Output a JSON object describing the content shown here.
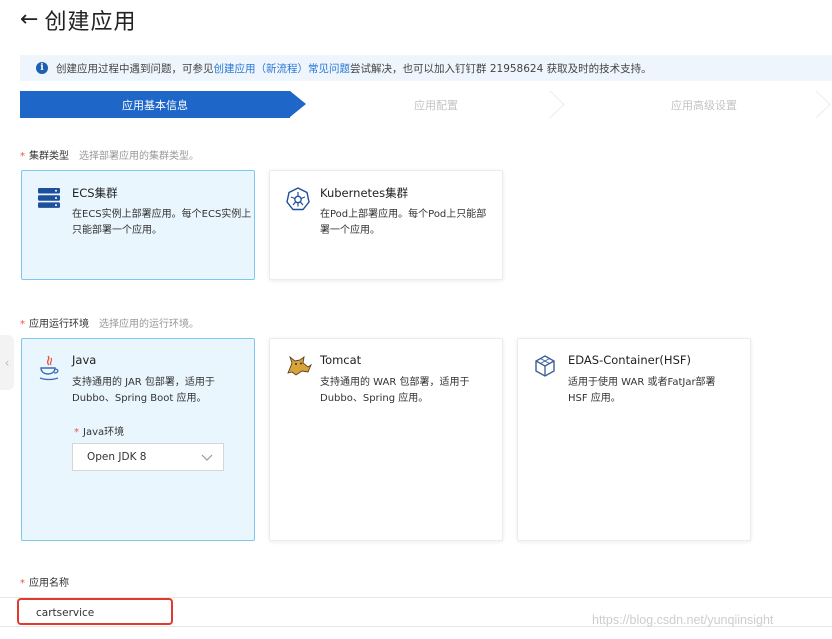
{
  "header": {
    "back_icon": "arrow-left-icon",
    "title": "创建应用"
  },
  "notice": {
    "icon": "info-icon",
    "text_before": "创建应用过程中遇到问题，可参见",
    "link": "创建应用（新流程）常见问题",
    "text_after": "尝试解决，也可以加入钉钉群 21958624 获取及时的技术支持。"
  },
  "steps": [
    {
      "label": "应用基本信息",
      "active": true
    },
    {
      "label": "应用配置",
      "active": false
    },
    {
      "label": "应用高级设置",
      "active": false
    }
  ],
  "cluster_type": {
    "label": "集群类型",
    "hint": "选择部署应用的集群类型。",
    "options": [
      {
        "title": "ECS集群",
        "desc": "在ECS实例上部署应用。每个ECS实例上只能部署一个应用。",
        "icon": "server-stack-icon",
        "selected": true
      },
      {
        "title": "Kubernetes集群",
        "desc": "在Pod上部署应用。每个Pod上只能部署一个应用。",
        "icon": "kubernetes-helm-icon",
        "selected": false
      }
    ]
  },
  "runtime_env": {
    "label": "应用运行环境",
    "hint": "选择应用的运行环境。",
    "options": [
      {
        "title": "Java",
        "desc": "支持通用的 JAR 包部署，适用于 Dubbo、Spring Boot 应用。",
        "icon": "java-coffee-icon",
        "selected": true
      },
      {
        "title": "Tomcat",
        "desc": "支持通用的 WAR 包部署，适用于 Dubbo、Spring 应用。",
        "icon": "tomcat-cat-icon",
        "selected": false
      },
      {
        "title": "EDAS-Container(HSF)",
        "desc": "适用于使用 WAR 或者FatJar部署 HSF 应用。",
        "icon": "cube-icon",
        "selected": false
      }
    ],
    "java_env_label": "Java环境",
    "java_env_value": "Open JDK 8"
  },
  "app_name": {
    "label": "应用名称",
    "value": "cartservice"
  },
  "watermark": "https://blog.csdn.net/yunqiinsight",
  "colors": {
    "primary": "#1e66c8",
    "selected_bg": "#eaf6fd",
    "selected_border": "#7fc7ee",
    "required": "#e8553e",
    "highlight": "#e0392e"
  }
}
